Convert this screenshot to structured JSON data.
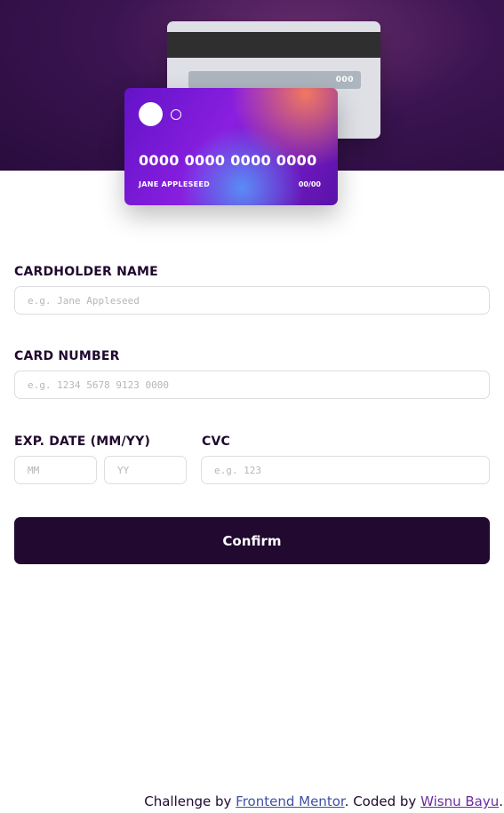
{
  "card_back": {
    "cvc": "000"
  },
  "card_front": {
    "number": "0000 0000 0000 0000",
    "name": "JANE APPLESEED",
    "expiry": "00/00"
  },
  "form": {
    "cardholder_label": "CARDHOLDER NAME",
    "cardholder_placeholder": "e.g. Jane Appleseed",
    "number_label": "CARD NUMBER",
    "number_placeholder": "e.g. 1234 5678 9123 0000",
    "expiry_label": "EXP. DATE (MM/YY)",
    "month_placeholder": "MM",
    "year_placeholder": "YY",
    "cvc_label": "CVC",
    "cvc_placeholder": "e.g. 123",
    "confirm_label": "Confirm"
  },
  "footer": {
    "challenge_prefix": "Challenge by ",
    "challenge_link": "Frontend Mentor",
    "coded_prefix": ". Coded by ",
    "author_link": "Wisnu Bayu",
    "suffix": "."
  }
}
